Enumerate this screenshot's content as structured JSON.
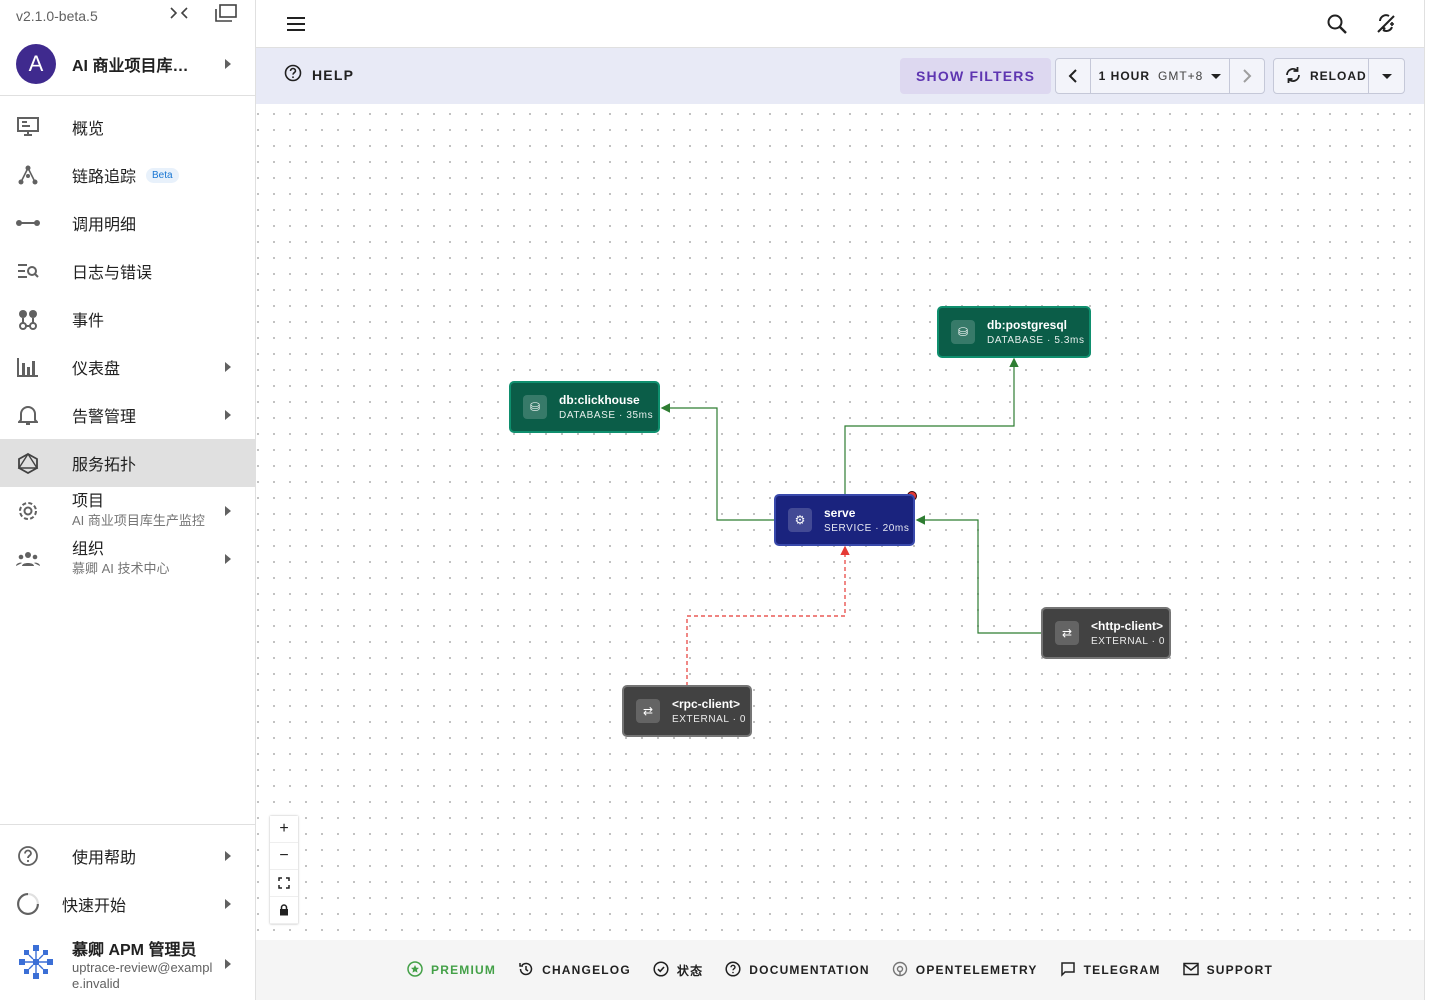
{
  "version": "v2.1.0-beta.5",
  "project": {
    "avatar_letter": "A",
    "name": "AI 商业项目库生产监控"
  },
  "nav": {
    "overview": "概览",
    "tracing": "链路追踪",
    "beta": "Beta",
    "spans": "调用明细",
    "logs": "日志与错误",
    "events": "事件",
    "dashboards": "仪表盘",
    "alerts": "告警管理",
    "topology": "服务拓扑",
    "project_label": "项目",
    "project_sub": "AI 商业项目库生产监控",
    "org_label": "组织",
    "org_sub": "慕卿 AI 技术中心"
  },
  "bottom_nav": {
    "help": "使用帮助",
    "quickstart": "快速开始",
    "user_name": "慕卿 APM 管理员",
    "user_email": "uptrace-review@example.invalid"
  },
  "toolbar": {
    "help": "HELP",
    "show_filters": "SHOW FILTERS",
    "period": "1 HOUR",
    "timezone": "GMT+8",
    "reload": "RELOAD"
  },
  "graph": {
    "nodes": {
      "postgres": {
        "title": "db:postgresql",
        "sub": "DATABASE · 5.3ms"
      },
      "clickhouse": {
        "title": "db:clickhouse",
        "sub": "DATABASE · 35ms"
      },
      "serve": {
        "title": "serve",
        "sub": "SERVICE · 20ms"
      },
      "http": {
        "title": "<http-client>",
        "sub": "EXTERNAL · 0"
      },
      "rpc": {
        "title": "<rpc-client>",
        "sub": "EXTERNAL · 0"
      }
    },
    "edge_colors": {
      "ok": "#2e7d32",
      "error": "#e53935"
    }
  },
  "footer": {
    "premium": "PREMIUM",
    "changelog": "CHANGELOG",
    "status": "状态",
    "documentation": "DOCUMENTATION",
    "opentelemetry": "OPENTELEMETRY",
    "telegram": "TELEGRAM",
    "support": "SUPPORT"
  }
}
